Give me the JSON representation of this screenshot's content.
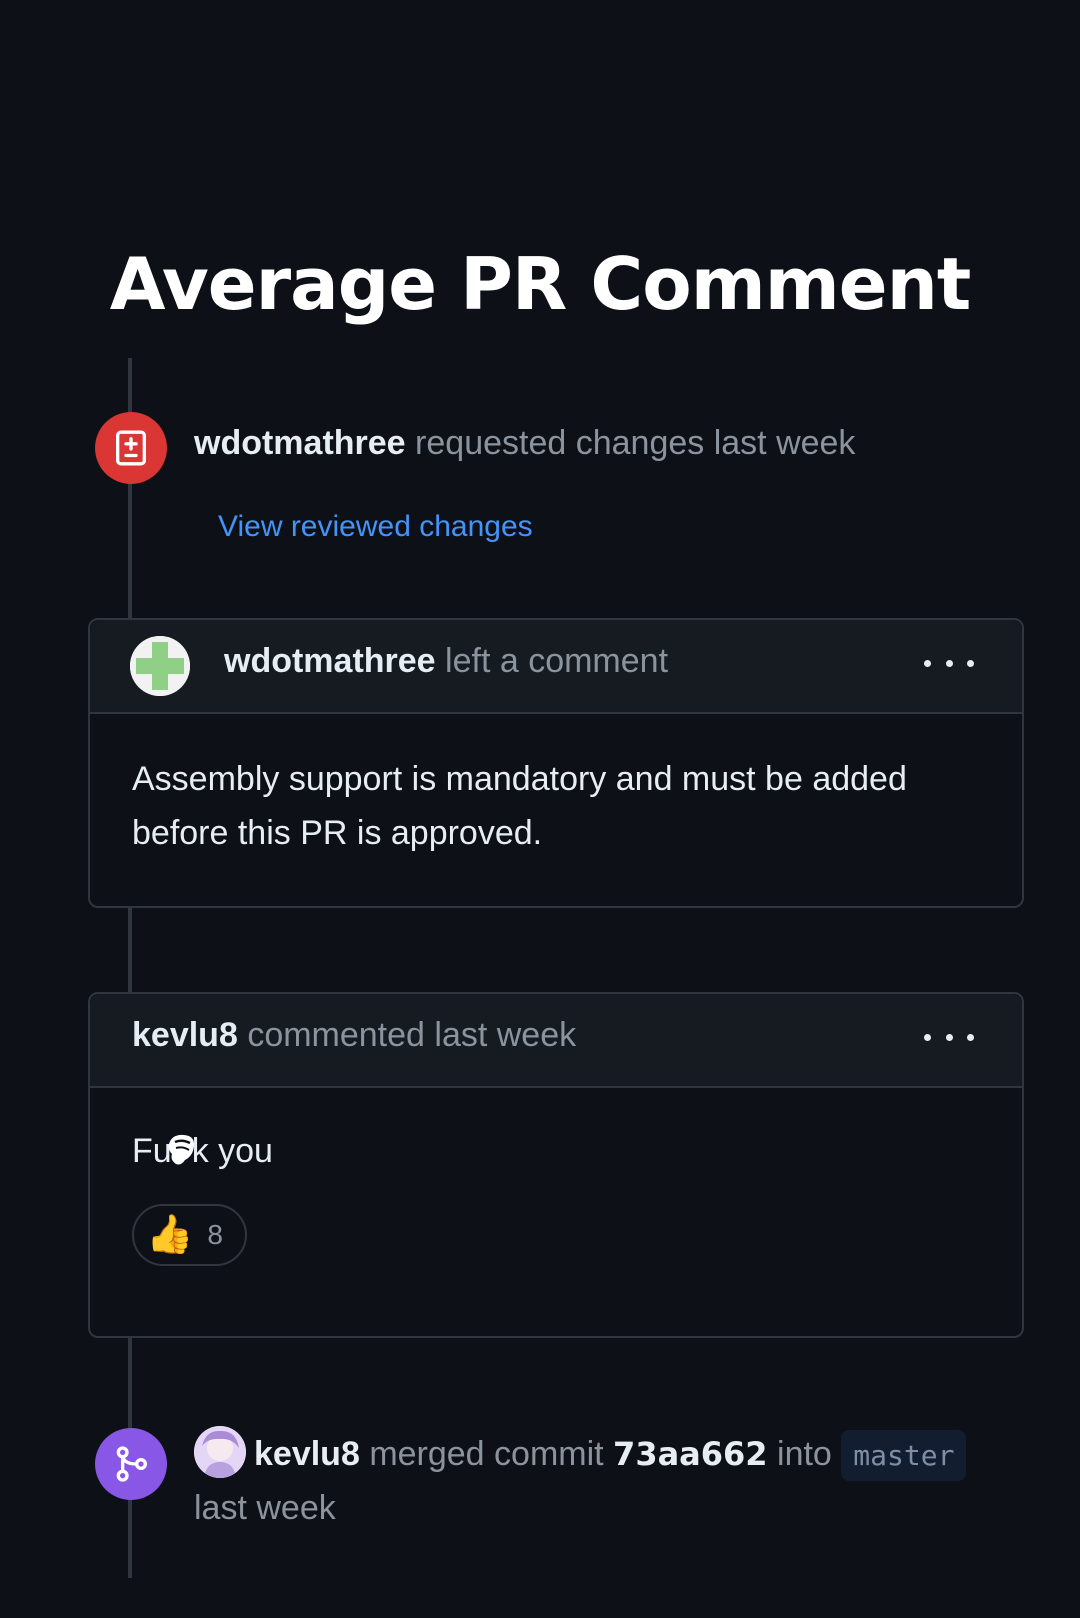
{
  "title": "Average PR Comment",
  "review_event": {
    "user": "wdotmathree",
    "action": "requested changes last week",
    "link": "View reviewed changes",
    "badge_color": "#da3633"
  },
  "comment1": {
    "user": "wdotmathree",
    "action": "left a comment",
    "body": "Assembly support is mandatory and must be added before this PR is approved."
  },
  "comment2": {
    "user": "kevlu8",
    "action": "commented last week",
    "body_prefix": "Fu",
    "body_suffix": "k you",
    "reaction": {
      "emoji": "👍",
      "count": "8"
    }
  },
  "merge_event": {
    "user": "kevlu8",
    "text1": "merged commit",
    "sha": "73aa662",
    "text2": "into",
    "branch": "master",
    "time": "last week",
    "badge_color": "#8957e5"
  },
  "icons": {
    "review": "file-diff-icon",
    "merge": "git-merge-icon",
    "more": "kebab-horizontal-icon"
  }
}
